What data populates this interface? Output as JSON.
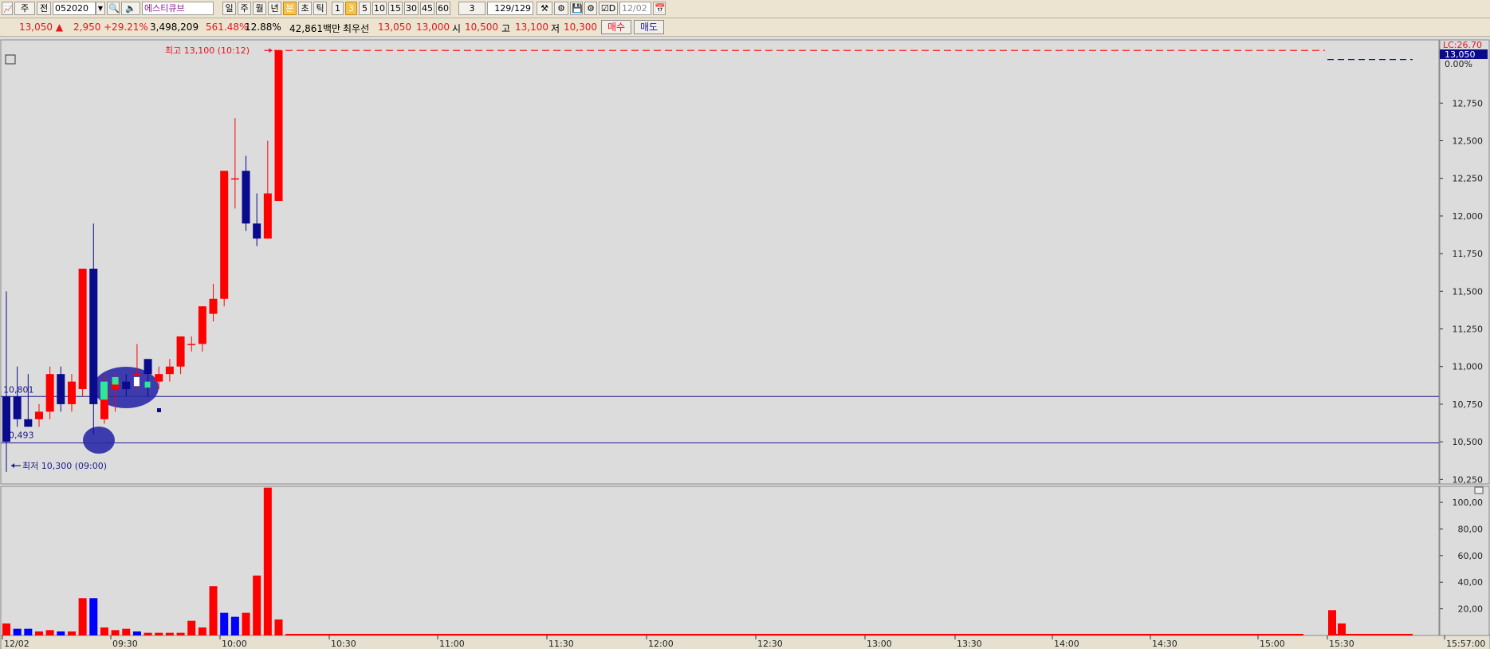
{
  "toolbar": {
    "stock_type": "주",
    "market": "전",
    "code": "052020",
    "stock_name": "에스티큐브",
    "periods": [
      "일",
      "주",
      "월",
      "년",
      "분",
      "초",
      "틱"
    ],
    "selected_period": "분",
    "intervals": [
      "1",
      "3",
      "5",
      "10",
      "15",
      "30",
      "45",
      "60"
    ],
    "selected_interval": "3",
    "interval_value": "3",
    "count": "129",
    "count_total": "/129",
    "date_checkbox": "D",
    "date": "12/02"
  },
  "quote": {
    "price": "13,050",
    "change": "2,950",
    "change_pct": "+29.21%",
    "volume": "3,498,209",
    "volume_ratio": "561.48%",
    "turnover": "12.88%",
    "amount": "42,861백만",
    "best_bid_label": "최우선",
    "best_ask": "13,050",
    "best_bid": "13,000",
    "open_label": "시",
    "open": "10,500",
    "high_label": "고",
    "high": "13,100",
    "low_label": "저",
    "low": "10,300",
    "buy_button": "매수",
    "sell_button": "매도"
  },
  "colors": {
    "up": "#ff0000",
    "down": "#0a0a8c",
    "volume_up": "#ff0000",
    "volume_down": "#0000ff",
    "hline": "#1c1c8c",
    "current_box": "#0a0a8c",
    "accent_green": "#2ee89a"
  },
  "chart_data": [
    {
      "type": "candlestick",
      "interval": "3분",
      "y_ticks": [
        "12,750",
        "12,500",
        "12,250",
        "12,000",
        "11,750",
        "11,500",
        "11,250",
        "11,000",
        "10,750",
        "10,500",
        "10,250"
      ],
      "ylim": [
        10220,
        13170
      ],
      "x_ticks": [
        "12/02",
        "09:30",
        "10:00",
        "10:30",
        "11:00",
        "11:30",
        "12:00",
        "12:30",
        "13:00",
        "13:30",
        "14:00",
        "14:30",
        "15:00",
        "15:30",
        "15:57:00"
      ],
      "candles": [
        {
          "o": 10800,
          "h": 11500,
          "l": 10300,
          "c": 10500
        },
        {
          "o": 10800,
          "h": 11000,
          "l": 10600,
          "c": 10650
        },
        {
          "o": 10650,
          "h": 10950,
          "l": 10600,
          "c": 10600
        },
        {
          "o": 10650,
          "h": 10750,
          "l": 10600,
          "c": 10700
        },
        {
          "o": 10700,
          "h": 11000,
          "l": 10650,
          "c": 10950
        },
        {
          "o": 10950,
          "h": 11000,
          "l": 10700,
          "c": 10750
        },
        {
          "o": 10750,
          "h": 10950,
          "l": 10700,
          "c": 10900
        },
        {
          "o": 10850,
          "h": 11650,
          "l": 10800,
          "c": 11650
        },
        {
          "o": 11650,
          "h": 11950,
          "l": 10550,
          "c": 10750
        },
        {
          "o": 10650,
          "h": 10950,
          "l": 10620,
          "c": 10850
        },
        {
          "o": 10850,
          "h": 10950,
          "l": 10700,
          "c": 10900
        },
        {
          "o": 10900,
          "h": 10950,
          "l": 10800,
          "c": 10850
        },
        {
          "o": 10950,
          "h": 11150,
          "l": 10850,
          "c": 10950
        },
        {
          "o": 11050,
          "h": 11050,
          "l": 10800,
          "c": 10950
        },
        {
          "o": 10900,
          "h": 11000,
          "l": 10850,
          "c": 10950
        },
        {
          "o": 10950,
          "h": 11050,
          "l": 10900,
          "c": 11000
        },
        {
          "o": 11000,
          "h": 11200,
          "l": 10950,
          "c": 11200
        },
        {
          "o": 11150,
          "h": 11200,
          "l": 11100,
          "c": 11150
        },
        {
          "o": 11150,
          "h": 11400,
          "l": 11100,
          "c": 11400
        },
        {
          "o": 11350,
          "h": 11550,
          "l": 11300,
          "c": 11450
        },
        {
          "o": 11450,
          "h": 12300,
          "l": 11400,
          "c": 12300
        },
        {
          "o": 12250,
          "h": 12650,
          "l": 12050,
          "c": 12250
        },
        {
          "o": 12300,
          "h": 12400,
          "l": 11900,
          "c": 11950
        },
        {
          "o": 11950,
          "h": 12150,
          "l": 11800,
          "c": 11850
        },
        {
          "o": 11850,
          "h": 12500,
          "l": 11850,
          "c": 12150
        },
        {
          "o": 12100,
          "h": 13100,
          "l": 12100,
          "c": 13100
        }
      ],
      "high_annotation": "최고 13,100 (10:12)",
      "low_annotation": "최저 10,300 (09:00)",
      "hlines": [
        {
          "value": 10801,
          "label": "10,801"
        },
        {
          "value": 10493,
          "label": "10,493"
        }
      ],
      "lc_label": "LC:26.70",
      "current_price_label": "13,050",
      "current_pct_label": "0.00%"
    },
    {
      "type": "bar",
      "title": "volume",
      "y_ticks": [
        "100,00",
        "80,00",
        "60,00",
        "40,00",
        "20,00"
      ],
      "ylim": [
        0,
        112
      ],
      "volume_early": [
        [
          9,
          1
        ],
        [
          5,
          0
        ],
        [
          5,
          0
        ],
        [
          3,
          1
        ],
        [
          4,
          1
        ],
        [
          3,
          0
        ],
        [
          3,
          1
        ],
        [
          28,
          1
        ],
        [
          28,
          0
        ],
        [
          6,
          1
        ],
        [
          4,
          1
        ],
        [
          5,
          1
        ],
        [
          3,
          0
        ],
        [
          2,
          1
        ],
        [
          2,
          1
        ],
        [
          2,
          1
        ],
        [
          2,
          1
        ],
        [
          11,
          1
        ],
        [
          6,
          1
        ],
        [
          37,
          1
        ],
        [
          17,
          0
        ],
        [
          14,
          0
        ],
        [
          17,
          1
        ],
        [
          45,
          1
        ],
        [
          111,
          1
        ],
        [
          12,
          1
        ]
      ],
      "volume_late": [
        [
          19,
          1
        ],
        [
          9,
          1
        ]
      ]
    }
  ]
}
